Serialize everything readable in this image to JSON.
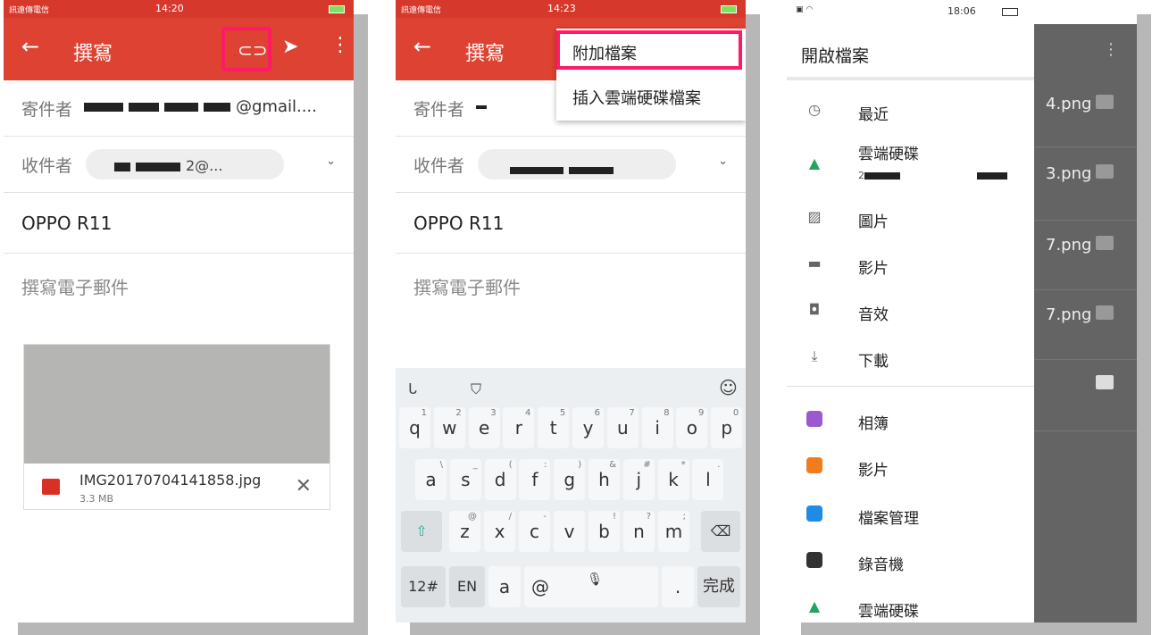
{
  "p1": {
    "status": {
      "carrier": "訊遠傳電信",
      "time": "14:20"
    },
    "title": "撰寫",
    "from_label": "寄件者",
    "from_suffix": "@gmail....",
    "to_label": "收件者",
    "to_suffix": "2@...",
    "subject": "OPPO R11",
    "body_placeholder": "撰寫電子郵件",
    "attachment": {
      "name": "IMG20170704141858.jpg",
      "size": "3.3 MB"
    }
  },
  "p2": {
    "status": {
      "carrier": "訊遠傳電信",
      "time": "14:23"
    },
    "title": "撰寫",
    "from_label": "寄件者",
    "to_label": "收件者",
    "subject": "OPPO R11",
    "body_placeholder": "撰寫電子郵件",
    "menu": [
      "附加檔案",
      "插入雲端硬碟檔案"
    ],
    "keyboard": {
      "row1": [
        [
          "q",
          "1"
        ],
        [
          "w",
          "2"
        ],
        [
          "e",
          "3"
        ],
        [
          "r",
          "4"
        ],
        [
          "t",
          "5"
        ],
        [
          "y",
          "6"
        ],
        [
          "u",
          "7"
        ],
        [
          "i",
          "8"
        ],
        [
          "o",
          "9"
        ],
        [
          "p",
          "0"
        ]
      ],
      "row2": [
        [
          "a",
          "\\"
        ],
        [
          "s",
          "_"
        ],
        [
          "d",
          "("
        ],
        [
          "f",
          ":"
        ],
        [
          "g",
          ")"
        ],
        [
          "h",
          "&"
        ],
        [
          "j",
          "#"
        ],
        [
          "k",
          "*"
        ],
        [
          "l",
          "."
        ]
      ],
      "row3": [
        [
          "z",
          "@"
        ],
        [
          "x",
          "/"
        ],
        [
          "c",
          "-"
        ],
        [
          "v",
          ""
        ],
        [
          "b",
          "!"
        ],
        [
          "n",
          "?"
        ],
        [
          "m",
          ";"
        ]
      ],
      "bottom": [
        "12#",
        "EN",
        "a",
        "@",
        ".",
        "完成"
      ],
      "shift_icon": "shift-icon",
      "backspace_icon": "backspace-icon"
    }
  },
  "p3": {
    "status": {
      "time": "18:06"
    },
    "title": "開啟檔案",
    "items": [
      "最近",
      "雲端硬碟",
      "圖片",
      "影片",
      "音效",
      "下載"
    ],
    "drive_account": "2",
    "apps": [
      "相簿",
      "影片",
      "檔案管理",
      "錄音機",
      "雲端硬碟"
    ],
    "files": [
      "4.png",
      "3.png",
      "7.png",
      "7.png"
    ]
  }
}
